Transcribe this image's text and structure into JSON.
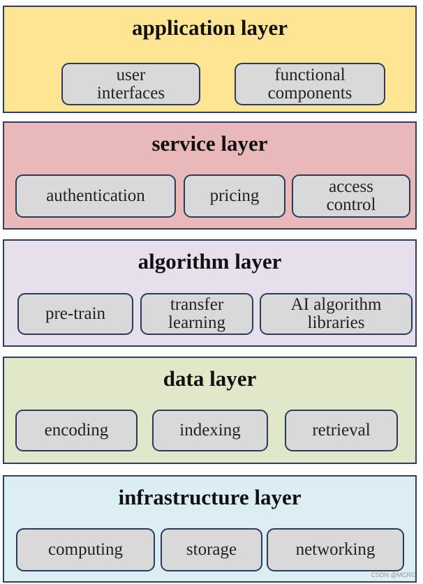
{
  "layers": [
    {
      "title": "application layer",
      "color": "#fee594",
      "items": [
        "user\ninterfaces",
        "functional\ncomponents"
      ]
    },
    {
      "title": "service layer",
      "color": "#e8b9b8",
      "items": [
        "authentication",
        "pricing",
        "access\ncontrol"
      ]
    },
    {
      "title": "algorithm layer",
      "color": "#e6e0ed",
      "items": [
        "pre-train",
        "transfer\nlearning",
        "AI algorithm\nlibraries"
      ]
    },
    {
      "title": "data layer",
      "color": "#e1e8c9",
      "items": [
        "encoding",
        "indexing",
        "retrieval"
      ]
    },
    {
      "title": "infrastructure layer",
      "color": "#dcedf4",
      "items": [
        "computing",
        "storage",
        "networking"
      ]
    }
  ],
  "watermark": "CSDN @MCRG"
}
